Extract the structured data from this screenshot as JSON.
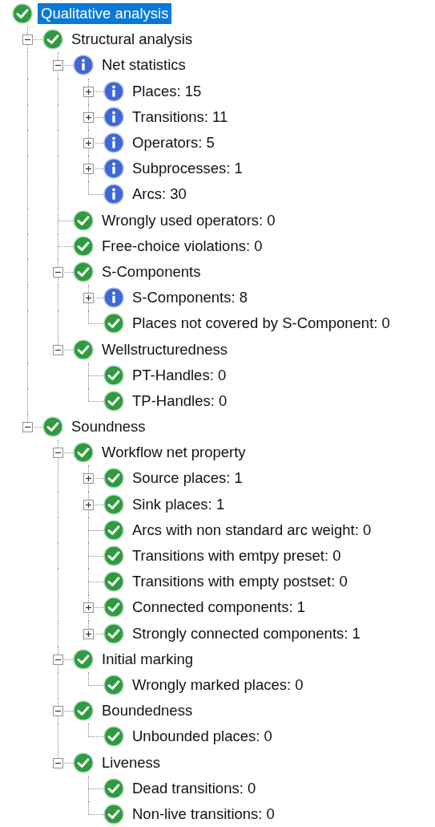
{
  "tree": [
    {
      "label": "Qualitative analysis",
      "kind": "check",
      "selected": true,
      "children": [
        {
          "label": "Structural analysis",
          "kind": "check",
          "selected": false,
          "expanded": true,
          "children": [
            {
              "label": "Net statistics",
              "kind": "info",
              "selected": false,
              "expanded": true,
              "children": [
                {
                  "label": "Places: 15",
                  "kind": "info",
                  "selected": false,
                  "expanded": false
                },
                {
                  "label": "Transitions: 11",
                  "kind": "info",
                  "selected": false,
                  "expanded": false
                },
                {
                  "label": "Operators: 5",
                  "kind": "info",
                  "selected": false,
                  "expanded": false
                },
                {
                  "label": "Subprocesses: 1",
                  "kind": "info",
                  "selected": false,
                  "expanded": false
                },
                {
                  "label": "Arcs: 30",
                  "kind": "info",
                  "selected": false
                }
              ]
            },
            {
              "label": "Wrongly used operators: 0",
              "kind": "check",
              "selected": false
            },
            {
              "label": "Free-choice violations: 0",
              "kind": "check",
              "selected": false
            },
            {
              "label": "S-Components",
              "kind": "check",
              "selected": false,
              "expanded": true,
              "children": [
                {
                  "label": "S-Components: 8",
                  "kind": "info",
                  "selected": false,
                  "expanded": false
                },
                {
                  "label": "Places not covered by S-Component: 0",
                  "kind": "check",
                  "selected": false
                }
              ]
            },
            {
              "label": "Wellstructuredness",
              "kind": "check",
              "selected": false,
              "expanded": true,
              "children": [
                {
                  "label": "PT-Handles: 0",
                  "kind": "check",
                  "selected": false
                },
                {
                  "label": "TP-Handles: 0",
                  "kind": "check",
                  "selected": false
                }
              ]
            }
          ]
        },
        {
          "label": "Soundness",
          "kind": "check",
          "selected": false,
          "expanded": true,
          "children": [
            {
              "label": "Workflow net property",
              "kind": "check",
              "selected": false,
              "expanded": true,
              "children": [
                {
                  "label": "Source places: 1",
                  "kind": "check",
                  "selected": false,
                  "expanded": false
                },
                {
                  "label": "Sink places: 1",
                  "kind": "check",
                  "selected": false,
                  "expanded": false
                },
                {
                  "label": "Arcs with non standard arc weight: 0",
                  "kind": "check",
                  "selected": false
                },
                {
                  "label": "Transitions with emtpy preset: 0",
                  "kind": "check",
                  "selected": false
                },
                {
                  "label": "Transitions with empty postset: 0",
                  "kind": "check",
                  "selected": false
                },
                {
                  "label": "Connected components: 1",
                  "kind": "check",
                  "selected": false,
                  "expanded": false
                },
                {
                  "label": "Strongly connected components: 1",
                  "kind": "check",
                  "selected": false,
                  "expanded": false
                }
              ]
            },
            {
              "label": "Initial marking",
              "kind": "check",
              "selected": false,
              "expanded": true,
              "children": [
                {
                  "label": "Wrongly marked places: 0",
                  "kind": "check",
                  "selected": false
                }
              ]
            },
            {
              "label": "Boundedness",
              "kind": "check",
              "selected": false,
              "expanded": true,
              "children": [
                {
                  "label": "Unbounded places: 0",
                  "kind": "check",
                  "selected": false
                }
              ]
            },
            {
              "label": "Liveness",
              "kind": "check",
              "selected": false,
              "expanded": true,
              "children": [
                {
                  "label": "Dead transitions: 0",
                  "kind": "check",
                  "selected": false
                },
                {
                  "label": "Non-live transitions: 0",
                  "kind": "check",
                  "selected": false
                }
              ]
            }
          ]
        }
      ]
    }
  ]
}
